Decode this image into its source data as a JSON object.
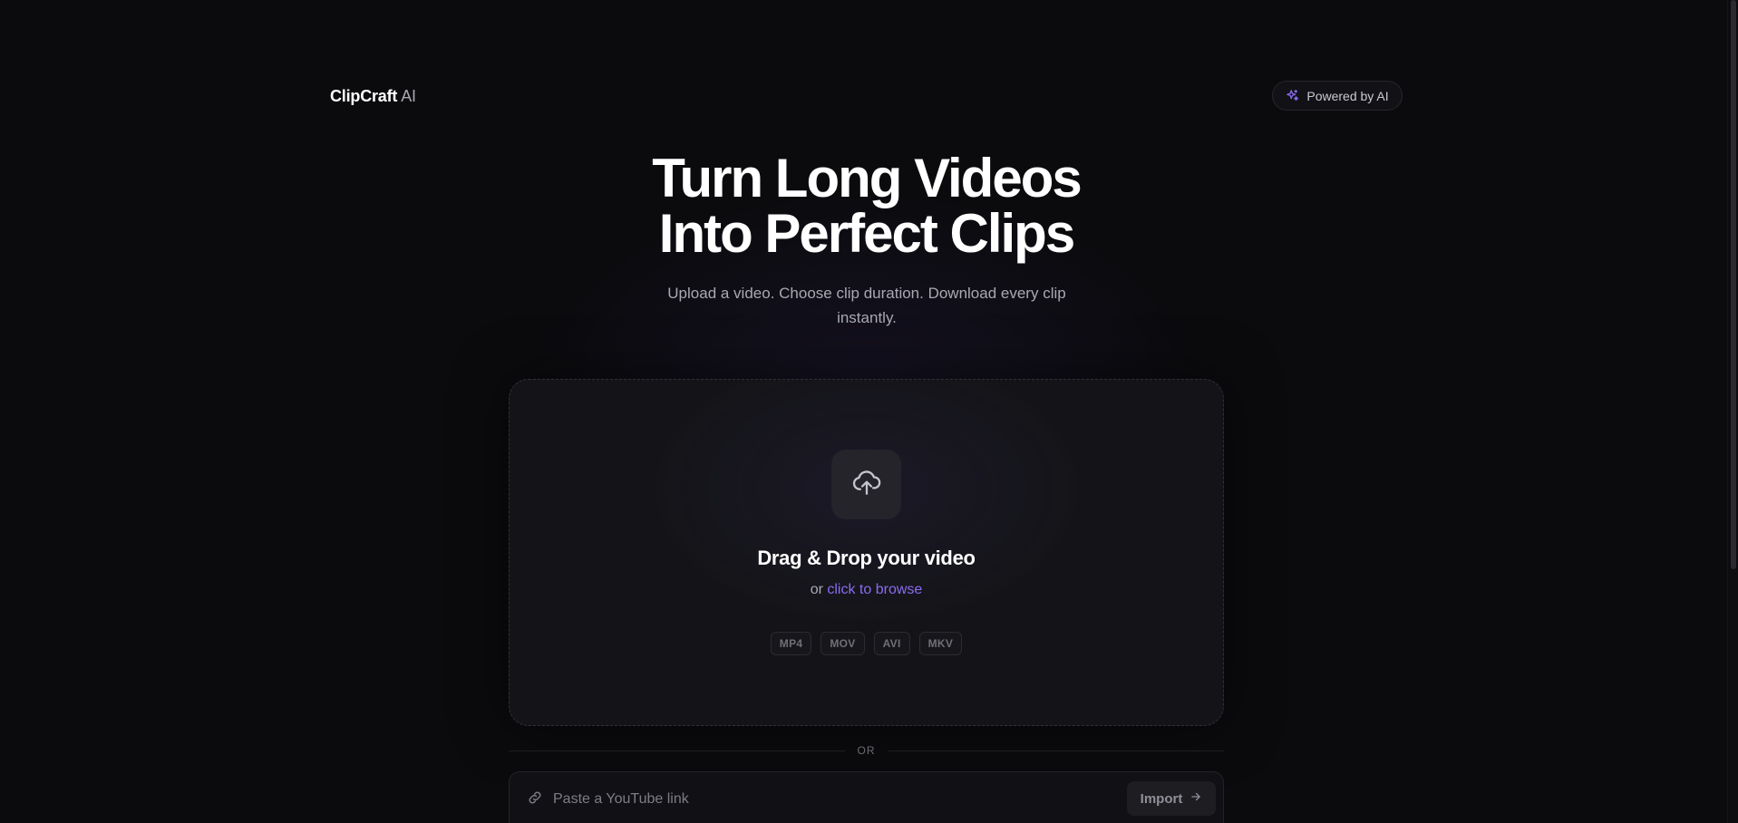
{
  "header": {
    "brand": "ClipCraft",
    "brand_suffix": "AI",
    "powered_label": "Powered by AI"
  },
  "hero": {
    "title_line1": "Turn Long Videos",
    "title_line2": "Into Perfect Clips",
    "subtitle": "Upload a video. Choose clip duration. Download every clip instantly."
  },
  "dropzone": {
    "icon": "cloud-upload-icon",
    "title": "Drag & Drop your video",
    "or_text": "or",
    "browse_link": "click to browse",
    "formats": [
      "MP4",
      "MOV",
      "AVI",
      "MKV"
    ]
  },
  "divider": {
    "label": "OR"
  },
  "url_import": {
    "icon": "link-icon",
    "placeholder": "Paste a YouTube link",
    "value": "",
    "button_label": "Import",
    "button_icon": "arrow-right-icon"
  },
  "colors": {
    "background": "#0b0b0e",
    "accent": "#8b6cf0",
    "card": "#141418"
  }
}
